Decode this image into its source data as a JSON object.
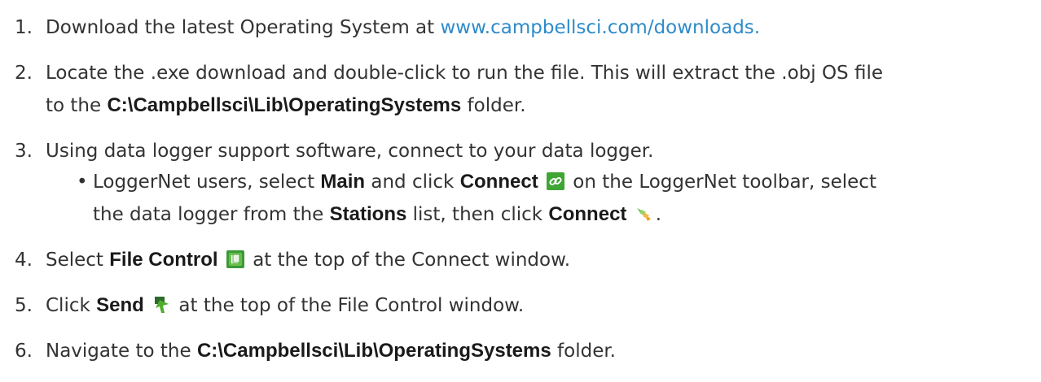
{
  "steps": [
    {
      "num": "1.",
      "pre": "Download the latest Operating System at ",
      "link": "www.campbellsci.com/downloads."
    },
    {
      "num": "2.",
      "line1": "Locate the .exe download and double-click to run the file. This will extract the .obj OS file",
      "line2_pre": "to the ",
      "path": "C:\\Campbellsci\\Lib\\OperatingSystems",
      "line2_post": " folder."
    },
    {
      "num": "3.",
      "text": "Using data logger support software, connect to your data logger.",
      "bullet": {
        "dot": "•",
        "a": "LoggerNet users, select ",
        "main": "Main",
        "b": " and click ",
        "connect1": "Connect",
        "c": " on the LoggerNet toolbar, select",
        "d": "the data logger from the ",
        "stations": "Stations",
        "e": " list, then click ",
        "connect2": "Connect",
        "f": "."
      }
    },
    {
      "num": "4.",
      "pre": "Select ",
      "bold": "File Control",
      "post": " at the top of the Connect window."
    },
    {
      "num": "5.",
      "pre": "Click ",
      "bold": "Send",
      "post": " at the top of the File Control window."
    },
    {
      "num": "6.",
      "pre": "Navigate to the ",
      "bold": "C:\\Campbellsci\\Lib\\OperatingSystems",
      "post": " folder."
    }
  ],
  "icons": {
    "connect_link": "chain-link-icon",
    "connect_plug": "plug-connect-icon",
    "file_control": "file-control-icon",
    "send": "send-arrow-icon"
  },
  "colors": {
    "link": "#2e8bc9",
    "text": "#333333"
  }
}
